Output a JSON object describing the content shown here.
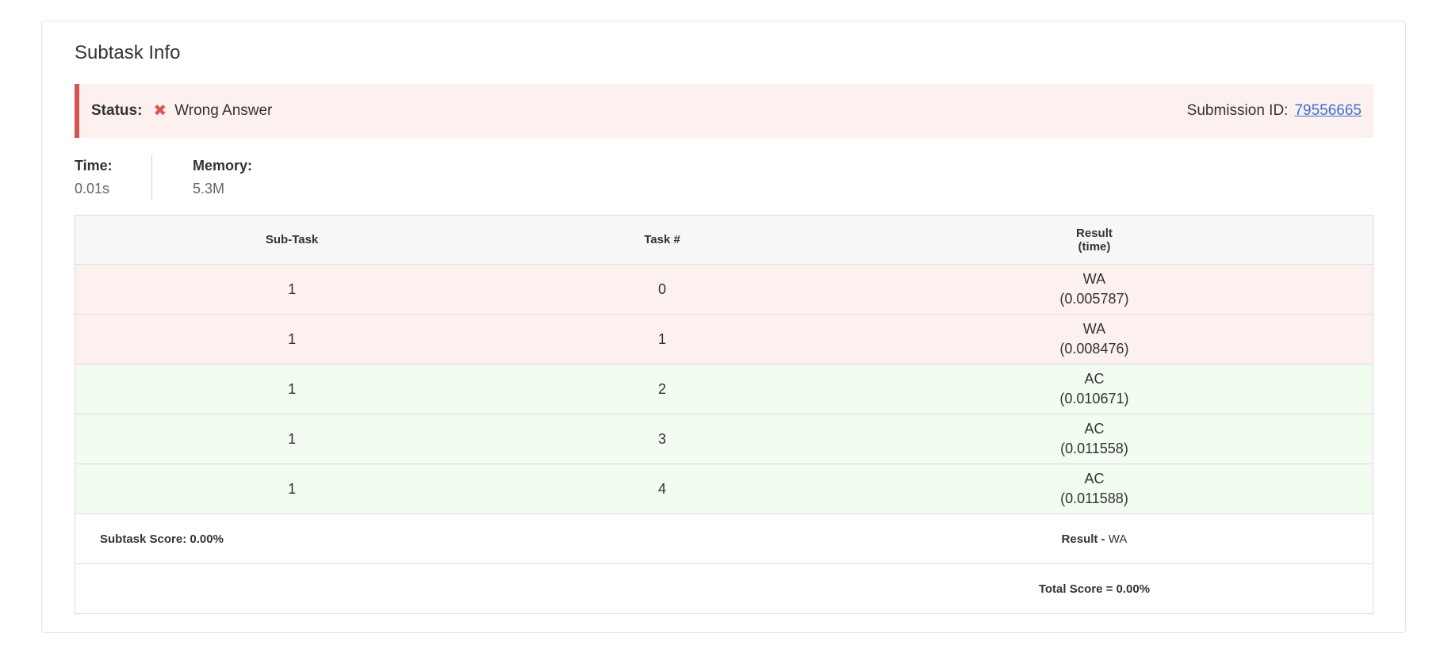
{
  "title": "Subtask Info",
  "status": {
    "label": "Status:",
    "icon": "x-icon",
    "icon_glyph": "✖",
    "value": "Wrong Answer",
    "color": "#d9534f"
  },
  "submission": {
    "label": "Submission ID:",
    "id": "79556665"
  },
  "stats": {
    "time_label": "Time:",
    "time_value": "0.01s",
    "memory_label": "Memory:",
    "memory_value": "5.3M"
  },
  "table": {
    "headers": {
      "subtask": "Sub-Task",
      "task": "Task #",
      "result_line1": "Result",
      "result_line2": "(time)"
    },
    "rows": [
      {
        "subtask": "1",
        "task": "0",
        "result": "WA",
        "time": "(0.005787)",
        "status": "wa"
      },
      {
        "subtask": "1",
        "task": "1",
        "result": "WA",
        "time": "(0.008476)",
        "status": "wa"
      },
      {
        "subtask": "1",
        "task": "2",
        "result": "AC",
        "time": "(0.010671)",
        "status": "ac"
      },
      {
        "subtask": "1",
        "task": "3",
        "result": "AC",
        "time": "(0.011558)",
        "status": "ac"
      },
      {
        "subtask": "1",
        "task": "4",
        "result": "AC",
        "time": "(0.011588)",
        "status": "ac"
      }
    ],
    "subtask_score": "Subtask Score: 0.00%",
    "result_label": "Result -",
    "result_value": "WA",
    "total_score": "Total Score = 0.00%"
  },
  "colors": {
    "wa_bg": "#fdf1f0",
    "ac_bg": "#f2fcf0",
    "link": "#3a72c8"
  }
}
